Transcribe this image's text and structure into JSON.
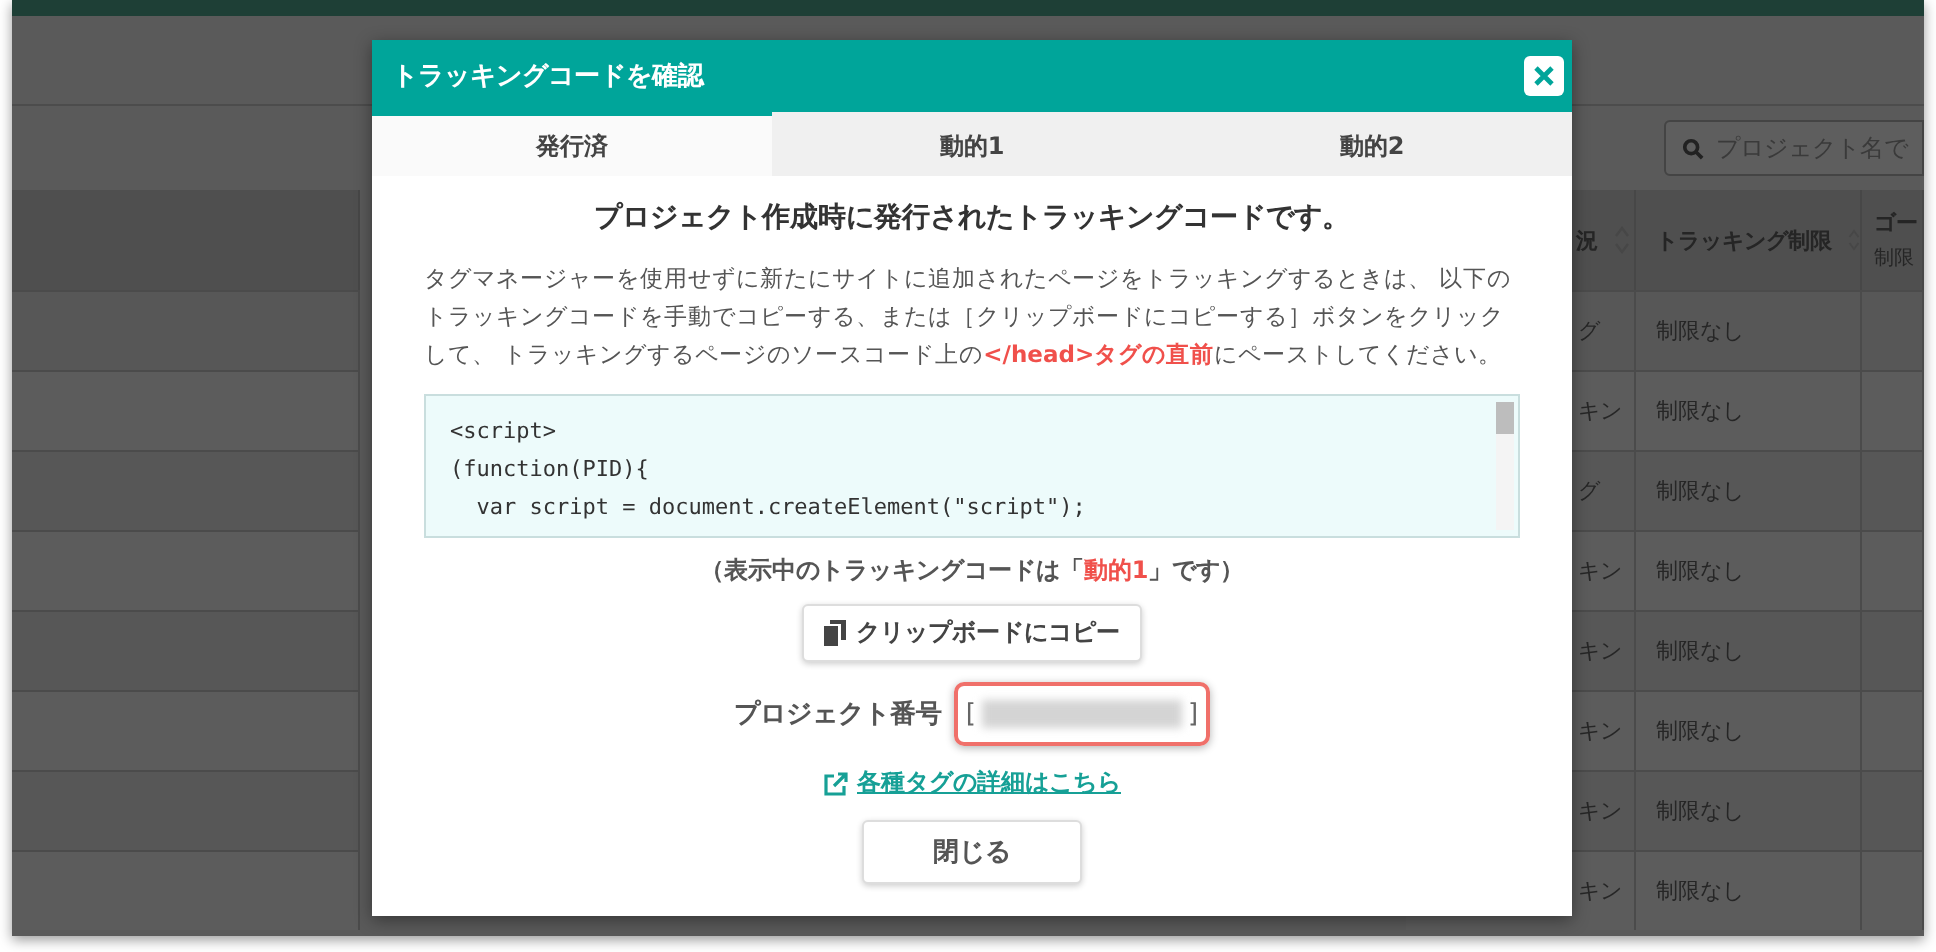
{
  "page": {
    "search": {
      "placeholder": "プロジェクト名で"
    },
    "table": {
      "columns": [
        {
          "label": "況"
        },
        {
          "label": "トラッキング制限"
        },
        {
          "label": "ゴー",
          "sub": "制限"
        }
      ],
      "rows": [
        {
          "column_1": "グ",
          "column_2": "制限なし"
        },
        {
          "column_1": "キン",
          "column_2": "制限なし"
        },
        {
          "column_1": "グ",
          "column_2": "制限なし"
        },
        {
          "column_1": "キン",
          "column_2": "制限なし"
        },
        {
          "column_1": "キン",
          "column_2": "制限なし"
        },
        {
          "column_1": "キン",
          "column_2": "制限なし"
        },
        {
          "column_1": "キン",
          "column_2": "制限なし"
        },
        {
          "column_1": "キン",
          "column_2": "制限なし"
        }
      ]
    }
  },
  "dialog": {
    "title": "トラッキングコードを確認",
    "tabs": [
      {
        "label": "発行済",
        "selected": true
      },
      {
        "label": "動的1",
        "selected": false
      },
      {
        "label": "動的2",
        "selected": false
      }
    ],
    "heading": "プロジェクト作成時に発行されたトラッキングコードです。",
    "description": "タグマネージャーを使用せずに新たにサイトに追加されたページをトラッキングするときは、 以下のトラッキングコードを手動でコピーする、または［クリップボードにコピーする］ボタンをクリックして、 トラッキングするページのソースコード上の**</head>タグの直前**にペーストしてください。",
    "code_lines": [
      "<script>",
      "(function(PID){",
      "  var script = document.createElement(\"script\");"
    ],
    "current_note": "（表示中のトラッキングコードは「**動的1**」です）",
    "copy_button": "クリップボードにコピー",
    "project_number": {
      "label": "プロジェクト番号",
      "open_bracket": "[",
      "close_bracket": "]"
    },
    "details_link": "各種タグの詳細はこちら",
    "close_button": "閉じる"
  }
}
